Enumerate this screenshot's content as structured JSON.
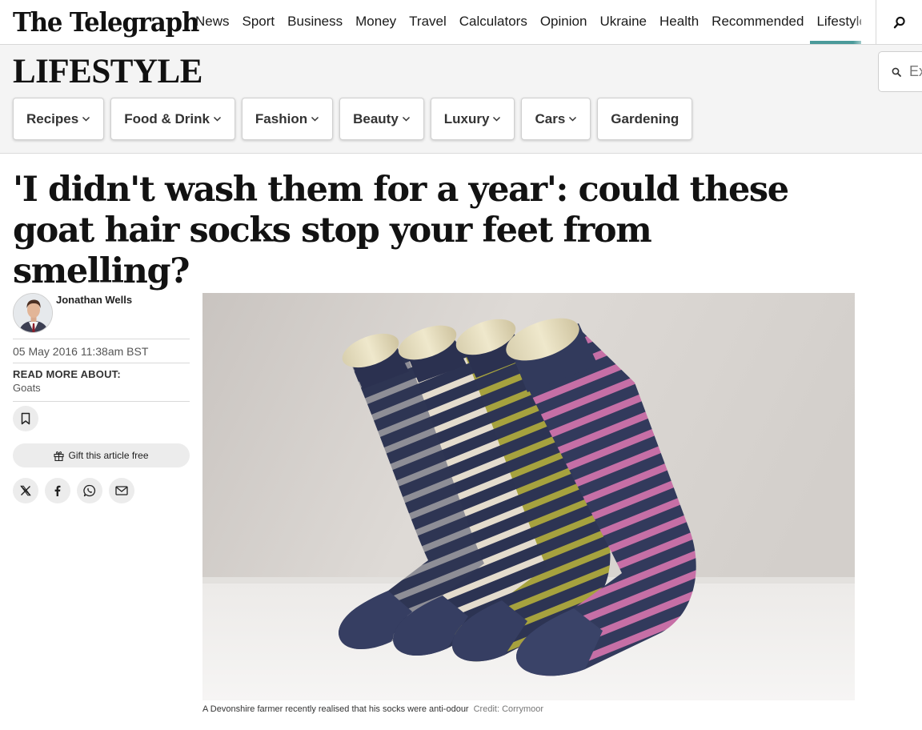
{
  "site": {
    "logo_text": "The Telegraph",
    "nav": [
      "News",
      "Sport",
      "Business",
      "Money",
      "Travel",
      "Calculators",
      "Opinion",
      "Ukraine",
      "Health",
      "Recommended",
      "Lifestyle"
    ],
    "active_nav": "Lifestyle",
    "accent": "#4a9a9a"
  },
  "section": {
    "title": "LIFESTYLE",
    "search_placeholder": "Ex",
    "subnav": [
      {
        "label": "Recipes",
        "dropdown": true
      },
      {
        "label": "Food & Drink",
        "dropdown": true
      },
      {
        "label": "Fashion",
        "dropdown": true
      },
      {
        "label": "Beauty",
        "dropdown": true
      },
      {
        "label": "Luxury",
        "dropdown": true
      },
      {
        "label": "Cars",
        "dropdown": true
      },
      {
        "label": "Gardening",
        "dropdown": false
      }
    ]
  },
  "article": {
    "headline": "'I didn't wash them for a year': could these goat hair socks stop your feet from smelling?",
    "author": "Jonathan Wells",
    "date": "05 May 2016 11:38am BST",
    "read_more_label": "READ MORE ABOUT:",
    "topic": "Goats",
    "gift_label": "Gift this article free",
    "share_icons": [
      "x-icon",
      "facebook-icon",
      "whatsapp-icon",
      "email-icon"
    ],
    "image_caption": "A Devonshire farmer recently realised that his socks were anti-odour",
    "image_credit": "Credit: Corrymoor"
  }
}
